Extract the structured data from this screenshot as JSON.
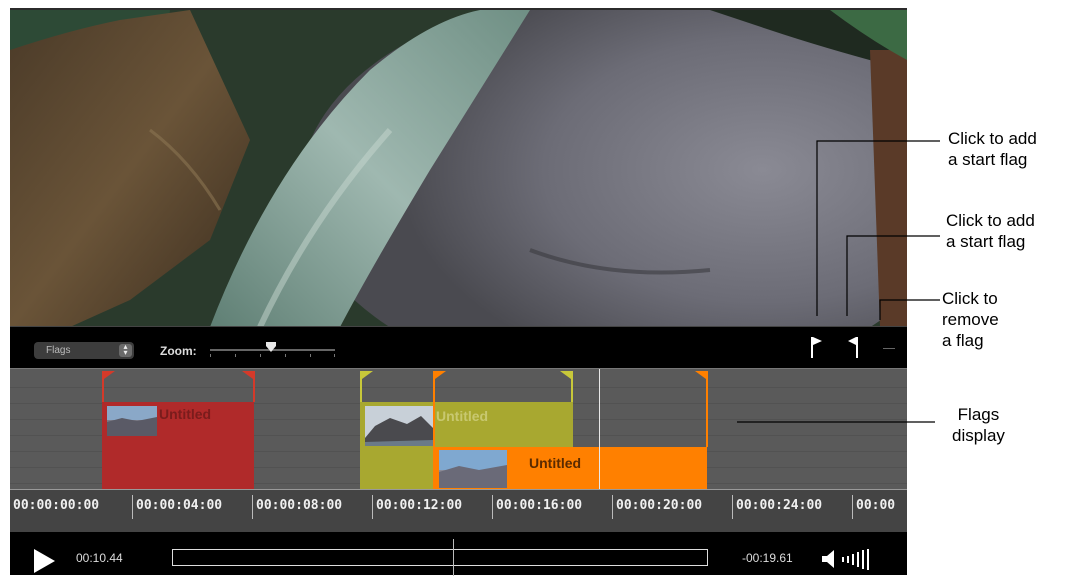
{
  "toolbar": {
    "mode_select": "Flags",
    "zoom_label": "Zoom:",
    "icons": [
      "start-flag-icon",
      "end-flag-icon",
      "remove-flag-icon"
    ]
  },
  "clips": [
    {
      "title": "Untitled",
      "color": "#b02a2a"
    },
    {
      "title": "Untitled",
      "color": "#a8a830"
    },
    {
      "title": "Untitled",
      "color": "#ff8000"
    }
  ],
  "ruler": {
    "labels": [
      "00:00:00:00",
      "00:00:04:00",
      "00:00:08:00",
      "00:00:12:00",
      "00:00:16:00",
      "00:00:20:00",
      "00:00:24:00",
      "00:00"
    ]
  },
  "transport": {
    "elapsed": "00:10.44",
    "remaining": "-00:19.61"
  },
  "callouts": {
    "start_flag": [
      "Click to add",
      "a start flag"
    ],
    "end_flag": [
      "Click to add",
      "a start flag"
    ],
    "remove_flag": [
      "Click to",
      "remove",
      "a flag"
    ],
    "flags_display": [
      "Flags",
      "display"
    ]
  },
  "colors": {
    "clip_red": "#b02a2a",
    "clip_olive": "#a8a830",
    "clip_orange": "#ff8000",
    "flag_orange": "#ff8000",
    "flag_red": "#d43a2a",
    "flag_yellow": "#c8c83a"
  }
}
